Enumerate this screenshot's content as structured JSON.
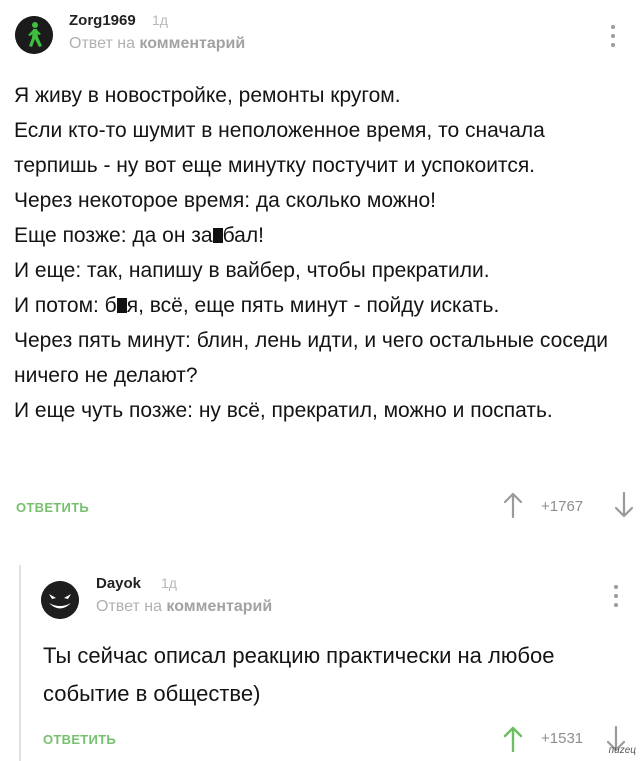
{
  "comments": [
    {
      "author": "Zorg1969",
      "age": "1д",
      "reply_prefix": "Ответ на",
      "reply_target": "комментарий",
      "lines": [
        "Я живу в новостройке, ремонты кругом.",
        "Если кто-то шумит в неположенное время, то сначала терпишь - ну вот еще минутку постучит и успокоится.",
        "Через некоторое время: да сколько можно!",
        [
          "Еще позже: да он за",
          "бал!"
        ],
        "И еще: так, напишу в вайбер, чтобы прекратили.",
        [
          "И потом: б",
          "я, всё, еще пять минут - пойду искать."
        ],
        "Через пять минут: блин, лень идти, и чего остальные соседи ничего не делают?",
        "И еще чуть позже: ну всё, прекратил, можно и поспать."
      ],
      "reply_label": "ОТВЕТИТЬ",
      "score": "+1767",
      "vote_up_color": "#9a9a9a",
      "avatar_icon": "walking-man-icon"
    },
    {
      "author": "Dayok",
      "age": "1д",
      "reply_prefix": "Ответ на",
      "reply_target": "комментарий",
      "text": "Ты сейчас описал реакцию практически на любое событие в обществе)",
      "reply_label": "ОТВЕТИТЬ",
      "score": "+1531",
      "vote_up_color": "#6dbd62",
      "avatar_icon": "grinning-face-icon"
    }
  ],
  "watermark": "пиzец"
}
